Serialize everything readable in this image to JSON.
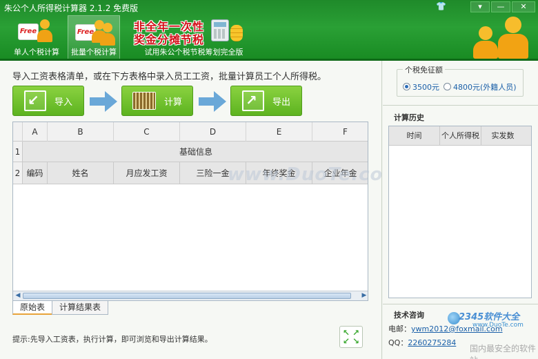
{
  "window": {
    "title": "朱公个人所得税计算器 2.1.2 免费版",
    "controls": {
      "skin": "shirt-icon",
      "menu": "▾",
      "minimize": "—",
      "close": "✕"
    }
  },
  "toolbar": {
    "single_label": "单人个税计算",
    "batch_label": "批量个税计算",
    "free_badge": "Free",
    "promo_line1": "非全年一次性",
    "promo_line2": "奖金分摊节税",
    "promo_sub": "试用朱公个税节税筹划完全版"
  },
  "main": {
    "instruction": "导入工资表格清单，或在下方表格中录入员工工资，批量计算员工个人所得税。",
    "buttons": {
      "import": "导入",
      "calculate": "计算",
      "export": "导出"
    },
    "sheet": {
      "column_headers": [
        "A",
        "B",
        "C",
        "D",
        "E",
        "F"
      ],
      "row1_num": "1",
      "row1_merged": "基础信息",
      "row2_num": "2",
      "row2_cells": [
        "编码",
        "姓名",
        "月应发工资",
        "三险一金",
        "年终奖金",
        "企业年金"
      ]
    },
    "tabs": [
      "原始表",
      "计算结果表"
    ],
    "hint": "提示:先导入工资表，执行计算，即可浏览和导出计算结果。",
    "watermark": "www.DuoTe.com"
  },
  "side": {
    "exemption": {
      "legend": "个税免征额",
      "option1": "3500元",
      "option2": "4800元(外籍人员)",
      "selected": 1
    },
    "history": {
      "title": "计算历史",
      "headers": [
        "时间",
        "个人所得税",
        "实发数"
      ]
    },
    "support": {
      "title": "技术咨询",
      "email_label": "电邮：",
      "email": "ywm2012@foxmail.com",
      "qq_label": "QQ：",
      "qq": "2260275284"
    },
    "corner": {
      "brand": "2345软件大全",
      "url": "www.DuoTe.com",
      "slogan": "国内最安全的软件站"
    }
  }
}
